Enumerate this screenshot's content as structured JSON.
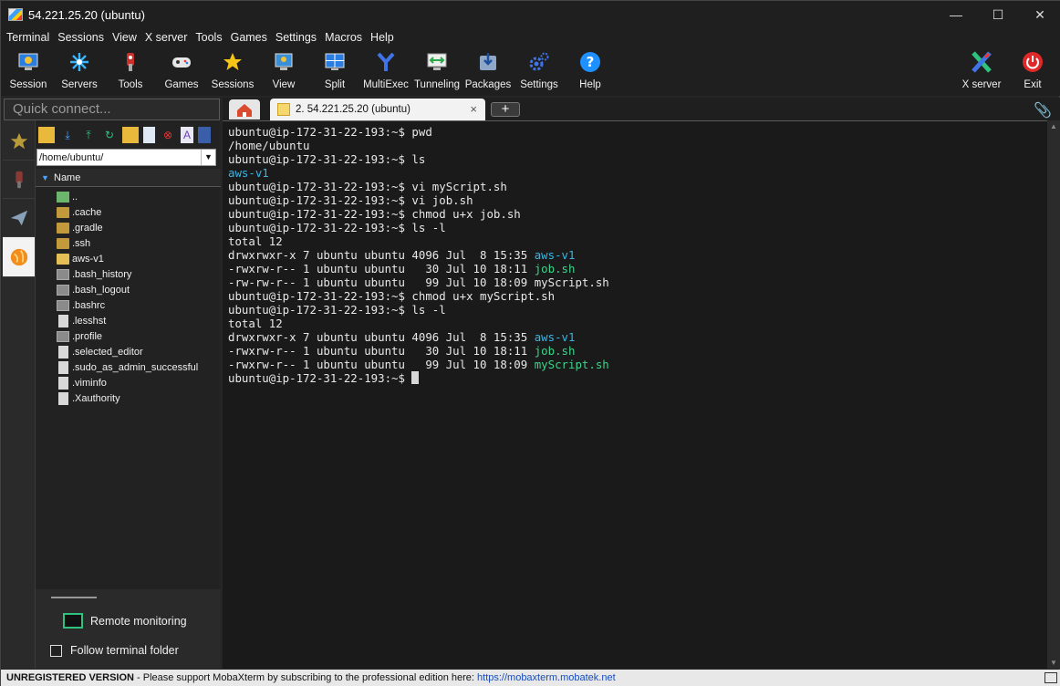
{
  "window": {
    "title": "54.221.25.20 (ubuntu)",
    "minimize": "—",
    "maximize": "☐",
    "close": "✕"
  },
  "menu": [
    "Terminal",
    "Sessions",
    "View",
    "X server",
    "Tools",
    "Games",
    "Settings",
    "Macros",
    "Help"
  ],
  "toolbar": {
    "session": "Session",
    "servers": "Servers",
    "tools": "Tools",
    "games": "Games",
    "sessions": "Sessions",
    "view": "View",
    "split": "Split",
    "multiexec": "MultiExec",
    "tunneling": "Tunneling",
    "packages": "Packages",
    "settings": "Settings",
    "help": "Help",
    "xserver": "X server",
    "exit": "Exit"
  },
  "quick_connect": {
    "placeholder": "Quick connect..."
  },
  "tabs": {
    "session_label": "2. 54.221.25.20 (ubuntu)",
    "close": "×",
    "add": "+"
  },
  "sftp": {
    "path": "/home/ubuntu/",
    "column": "Name",
    "files": [
      {
        "name": "..",
        "kind": "up"
      },
      {
        "name": ".cache",
        "kind": "folder"
      },
      {
        "name": ".gradle",
        "kind": "folder"
      },
      {
        "name": ".ssh",
        "kind": "folder"
      },
      {
        "name": "aws-v1",
        "kind": "folder-open"
      },
      {
        "name": ".bash_history",
        "kind": "file"
      },
      {
        "name": ".bash_logout",
        "kind": "file"
      },
      {
        "name": ".bashrc",
        "kind": "file"
      },
      {
        "name": ".lesshst",
        "kind": "doc"
      },
      {
        "name": ".profile",
        "kind": "file"
      },
      {
        "name": ".selected_editor",
        "kind": "doc"
      },
      {
        "name": ".sudo_as_admin_successful",
        "kind": "doc"
      },
      {
        "name": ".viminfo",
        "kind": "doc"
      },
      {
        "name": ".Xauthority",
        "kind": "doc"
      }
    ],
    "remote_monitoring": "Remote monitoring",
    "follow_terminal": "Follow terminal folder"
  },
  "terminal": {
    "lines": [
      [
        {
          "t": "ubuntu@ip-172-31-22-193:~$ pwd"
        }
      ],
      [
        {
          "t": "/home/ubuntu"
        }
      ],
      [
        {
          "t": "ubuntu@ip-172-31-22-193:~$ ls"
        }
      ],
      [
        {
          "t": "aws-v1",
          "c": "cyan"
        }
      ],
      [
        {
          "t": "ubuntu@ip-172-31-22-193:~$ vi myScript.sh"
        }
      ],
      [
        {
          "t": "ubuntu@ip-172-31-22-193:~$ vi job.sh"
        }
      ],
      [
        {
          "t": "ubuntu@ip-172-31-22-193:~$ chmod u+x job.sh"
        }
      ],
      [
        {
          "t": "ubuntu@ip-172-31-22-193:~$ ls -l"
        }
      ],
      [
        {
          "t": "total 12"
        }
      ],
      [
        {
          "t": "drwxrwxr-x 7 ubuntu ubuntu 4096 Jul  8 15:35 "
        },
        {
          "t": "aws-v1",
          "c": "cyan"
        }
      ],
      [
        {
          "t": "-rwxrw-r-- 1 ubuntu ubuntu   30 Jul 10 18:11 "
        },
        {
          "t": "job.sh",
          "c": "green"
        }
      ],
      [
        {
          "t": "-rw-rw-r-- 1 ubuntu ubuntu   99 Jul 10 18:09 myScript.sh"
        }
      ],
      [
        {
          "t": "ubuntu@ip-172-31-22-193:~$ chmod u+x myScript.sh"
        }
      ],
      [
        {
          "t": "ubuntu@ip-172-31-22-193:~$ ls -l"
        }
      ],
      [
        {
          "t": "total 12"
        }
      ],
      [
        {
          "t": "drwxrwxr-x 7 ubuntu ubuntu 4096 Jul  8 15:35 "
        },
        {
          "t": "aws-v1",
          "c": "cyan"
        }
      ],
      [
        {
          "t": "-rwxrw-r-- 1 ubuntu ubuntu   30 Jul 10 18:11 "
        },
        {
          "t": "job.sh",
          "c": "green"
        }
      ],
      [
        {
          "t": "-rwxrw-r-- 1 ubuntu ubuntu   99 Jul 10 18:09 "
        },
        {
          "t": "myScript.sh",
          "c": "green"
        }
      ],
      [
        {
          "t": "ubuntu@ip-172-31-22-193:~$ "
        }
      ]
    ]
  },
  "status": {
    "unregistered": "UNREGISTERED VERSION",
    "message": " -  Please support MobaXterm by subscribing to the professional edition here:  ",
    "link": "https://mobaxterm.mobatek.net"
  },
  "colors": {
    "accent": "#36b6e6",
    "executable": "#3fd28a",
    "background": "#1a1a1a"
  }
}
